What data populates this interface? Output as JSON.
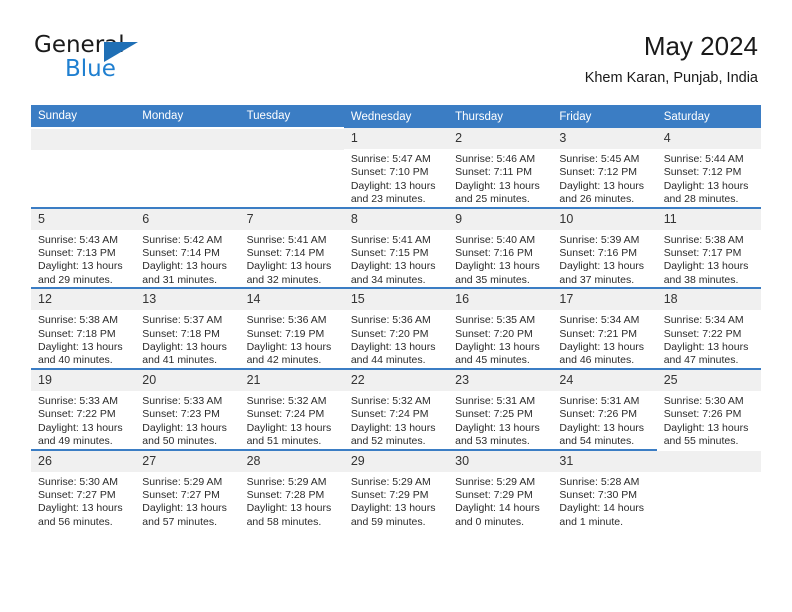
{
  "brand": {
    "name_part1": "General",
    "name_part2": "Blue",
    "triangle_icon": "triangle-icon"
  },
  "header": {
    "title": "May 2024",
    "subtitle": "Khem Karan, Punjab, India"
  },
  "colors": {
    "header_blue": "#3b7dc4",
    "daynum_band": "#f0f0f0",
    "brand_blue": "#1f7fd0",
    "text": "#2b2b2b"
  },
  "calendar": {
    "weekday_headers": [
      "Sunday",
      "Monday",
      "Tuesday",
      "Wednesday",
      "Thursday",
      "Friday",
      "Saturday"
    ],
    "weeks": [
      [
        {
          "day": "",
          "lines": [
            "",
            "",
            "",
            ""
          ],
          "empty": true
        },
        {
          "day": "",
          "lines": [
            "",
            "",
            "",
            ""
          ],
          "empty": true
        },
        {
          "day": "",
          "lines": [
            "",
            "",
            "",
            ""
          ],
          "empty": true
        },
        {
          "day": "1",
          "lines": [
            "Sunrise: 5:47 AM",
            "Sunset: 7:10 PM",
            "Daylight: 13 hours",
            "and 23 minutes."
          ],
          "empty": false
        },
        {
          "day": "2",
          "lines": [
            "Sunrise: 5:46 AM",
            "Sunset: 7:11 PM",
            "Daylight: 13 hours",
            "and 25 minutes."
          ],
          "empty": false
        },
        {
          "day": "3",
          "lines": [
            "Sunrise: 5:45 AM",
            "Sunset: 7:12 PM",
            "Daylight: 13 hours",
            "and 26 minutes."
          ],
          "empty": false
        },
        {
          "day": "4",
          "lines": [
            "Sunrise: 5:44 AM",
            "Sunset: 7:12 PM",
            "Daylight: 13 hours",
            "and 28 minutes."
          ],
          "empty": false
        }
      ],
      [
        {
          "day": "5",
          "lines": [
            "Sunrise: 5:43 AM",
            "Sunset: 7:13 PM",
            "Daylight: 13 hours",
            "and 29 minutes."
          ],
          "empty": false
        },
        {
          "day": "6",
          "lines": [
            "Sunrise: 5:42 AM",
            "Sunset: 7:14 PM",
            "Daylight: 13 hours",
            "and 31 minutes."
          ],
          "empty": false
        },
        {
          "day": "7",
          "lines": [
            "Sunrise: 5:41 AM",
            "Sunset: 7:14 PM",
            "Daylight: 13 hours",
            "and 32 minutes."
          ],
          "empty": false
        },
        {
          "day": "8",
          "lines": [
            "Sunrise: 5:41 AM",
            "Sunset: 7:15 PM",
            "Daylight: 13 hours",
            "and 34 minutes."
          ],
          "empty": false
        },
        {
          "day": "9",
          "lines": [
            "Sunrise: 5:40 AM",
            "Sunset: 7:16 PM",
            "Daylight: 13 hours",
            "and 35 minutes."
          ],
          "empty": false
        },
        {
          "day": "10",
          "lines": [
            "Sunrise: 5:39 AM",
            "Sunset: 7:16 PM",
            "Daylight: 13 hours",
            "and 37 minutes."
          ],
          "empty": false
        },
        {
          "day": "11",
          "lines": [
            "Sunrise: 5:38 AM",
            "Sunset: 7:17 PM",
            "Daylight: 13 hours",
            "and 38 minutes."
          ],
          "empty": false
        }
      ],
      [
        {
          "day": "12",
          "lines": [
            "Sunrise: 5:38 AM",
            "Sunset: 7:18 PM",
            "Daylight: 13 hours",
            "and 40 minutes."
          ],
          "empty": false
        },
        {
          "day": "13",
          "lines": [
            "Sunrise: 5:37 AM",
            "Sunset: 7:18 PM",
            "Daylight: 13 hours",
            "and 41 minutes."
          ],
          "empty": false
        },
        {
          "day": "14",
          "lines": [
            "Sunrise: 5:36 AM",
            "Sunset: 7:19 PM",
            "Daylight: 13 hours",
            "and 42 minutes."
          ],
          "empty": false
        },
        {
          "day": "15",
          "lines": [
            "Sunrise: 5:36 AM",
            "Sunset: 7:20 PM",
            "Daylight: 13 hours",
            "and 44 minutes."
          ],
          "empty": false
        },
        {
          "day": "16",
          "lines": [
            "Sunrise: 5:35 AM",
            "Sunset: 7:20 PM",
            "Daylight: 13 hours",
            "and 45 minutes."
          ],
          "empty": false
        },
        {
          "day": "17",
          "lines": [
            "Sunrise: 5:34 AM",
            "Sunset: 7:21 PM",
            "Daylight: 13 hours",
            "and 46 minutes."
          ],
          "empty": false
        },
        {
          "day": "18",
          "lines": [
            "Sunrise: 5:34 AM",
            "Sunset: 7:22 PM",
            "Daylight: 13 hours",
            "and 47 minutes."
          ],
          "empty": false
        }
      ],
      [
        {
          "day": "19",
          "lines": [
            "Sunrise: 5:33 AM",
            "Sunset: 7:22 PM",
            "Daylight: 13 hours",
            "and 49 minutes."
          ],
          "empty": false
        },
        {
          "day": "20",
          "lines": [
            "Sunrise: 5:33 AM",
            "Sunset: 7:23 PM",
            "Daylight: 13 hours",
            "and 50 minutes."
          ],
          "empty": false
        },
        {
          "day": "21",
          "lines": [
            "Sunrise: 5:32 AM",
            "Sunset: 7:24 PM",
            "Daylight: 13 hours",
            "and 51 minutes."
          ],
          "empty": false
        },
        {
          "day": "22",
          "lines": [
            "Sunrise: 5:32 AM",
            "Sunset: 7:24 PM",
            "Daylight: 13 hours",
            "and 52 minutes."
          ],
          "empty": false
        },
        {
          "day": "23",
          "lines": [
            "Sunrise: 5:31 AM",
            "Sunset: 7:25 PM",
            "Daylight: 13 hours",
            "and 53 minutes."
          ],
          "empty": false
        },
        {
          "day": "24",
          "lines": [
            "Sunrise: 5:31 AM",
            "Sunset: 7:26 PM",
            "Daylight: 13 hours",
            "and 54 minutes."
          ],
          "empty": false
        },
        {
          "day": "25",
          "lines": [
            "Sunrise: 5:30 AM",
            "Sunset: 7:26 PM",
            "Daylight: 13 hours",
            "and 55 minutes."
          ],
          "empty": false
        }
      ],
      [
        {
          "day": "26",
          "lines": [
            "Sunrise: 5:30 AM",
            "Sunset: 7:27 PM",
            "Daylight: 13 hours",
            "and 56 minutes."
          ],
          "empty": false
        },
        {
          "day": "27",
          "lines": [
            "Sunrise: 5:29 AM",
            "Sunset: 7:27 PM",
            "Daylight: 13 hours",
            "and 57 minutes."
          ],
          "empty": false
        },
        {
          "day": "28",
          "lines": [
            "Sunrise: 5:29 AM",
            "Sunset: 7:28 PM",
            "Daylight: 13 hours",
            "and 58 minutes."
          ],
          "empty": false
        },
        {
          "day": "29",
          "lines": [
            "Sunrise: 5:29 AM",
            "Sunset: 7:29 PM",
            "Daylight: 13 hours",
            "and 59 minutes."
          ],
          "empty": false
        },
        {
          "day": "30",
          "lines": [
            "Sunrise: 5:29 AM",
            "Sunset: 7:29 PM",
            "Daylight: 14 hours",
            "and 0 minutes."
          ],
          "empty": false
        },
        {
          "day": "31",
          "lines": [
            "Sunrise: 5:28 AM",
            "Sunset: 7:30 PM",
            "Daylight: 14 hours",
            "and 1 minute."
          ],
          "empty": false
        },
        {
          "day": "",
          "lines": [
            "",
            "",
            "",
            ""
          ],
          "empty": true
        }
      ]
    ]
  }
}
